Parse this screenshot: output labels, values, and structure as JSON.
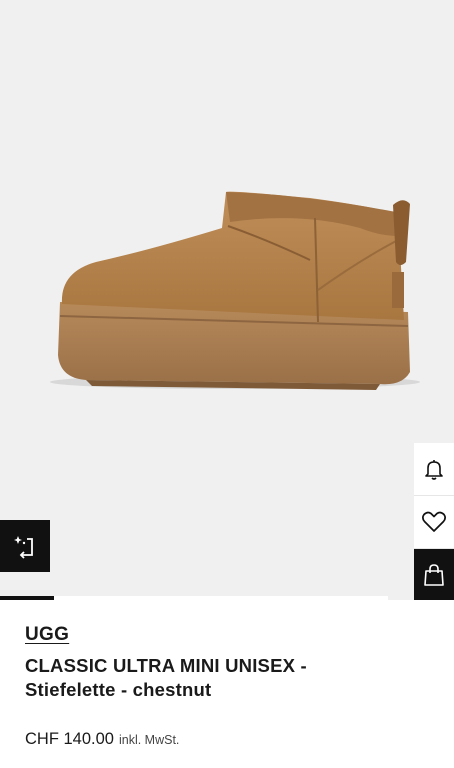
{
  "product": {
    "brand": "UGG",
    "name_line1": "CLASSIC ULTRA MINI UNISEX -",
    "name_line2": "Stiefelette - chestnut",
    "price": "CHF 140.00",
    "tax_note": "inkl. MwSt.",
    "color_hex": "#b07d4a"
  },
  "gallery": {
    "progress_fraction": 0.14,
    "background": "#f0f0f0"
  },
  "actions": {
    "icons": [
      "bell-icon",
      "heart-icon",
      "shopping-bag-icon",
      "compare-icon"
    ]
  }
}
